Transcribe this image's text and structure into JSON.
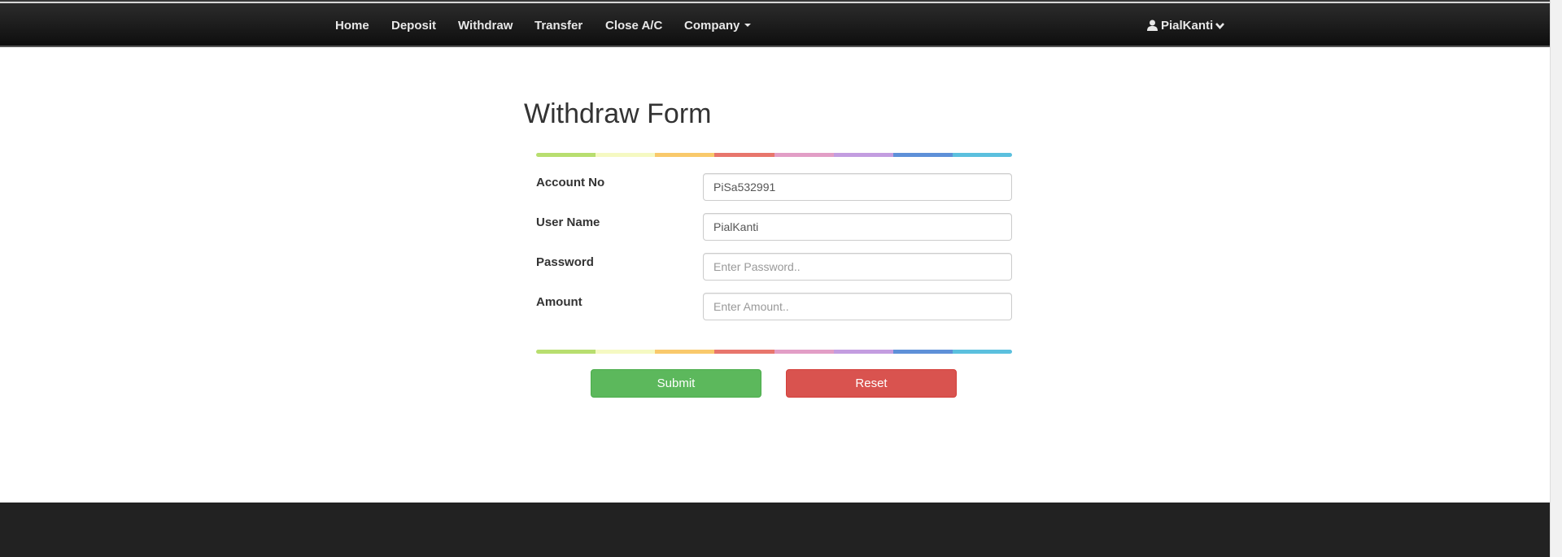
{
  "navbar": {
    "items": [
      {
        "label": "Home"
      },
      {
        "label": "Deposit"
      },
      {
        "label": "Withdraw"
      },
      {
        "label": "Transfer"
      },
      {
        "label": "Close A/C"
      },
      {
        "label": "Company"
      }
    ],
    "user": {
      "label": "PialKanti",
      "icon": "user-icon"
    }
  },
  "form": {
    "title": "Withdraw Form",
    "rainbow_colors": [
      "#b8de6f",
      "#f5f9c2",
      "#f9c96b",
      "#e8766c",
      "#e29ec6",
      "#c39de0",
      "#5e90d8",
      "#5bc0de"
    ],
    "fields": [
      {
        "label": "Account No",
        "value": "PiSa532991",
        "placeholder": ""
      },
      {
        "label": "User Name",
        "value": "PialKanti",
        "placeholder": ""
      },
      {
        "label": "Password",
        "value": "",
        "placeholder": "Enter Password.."
      },
      {
        "label": "Amount",
        "value": "",
        "placeholder": "Enter Amount.."
      }
    ],
    "submit_label": "Submit",
    "reset_label": "Reset"
  },
  "colors": {
    "submit": "#5cb85c",
    "reset": "#d9534f",
    "navbar": "#1a1a1a",
    "footer": "#222222"
  }
}
